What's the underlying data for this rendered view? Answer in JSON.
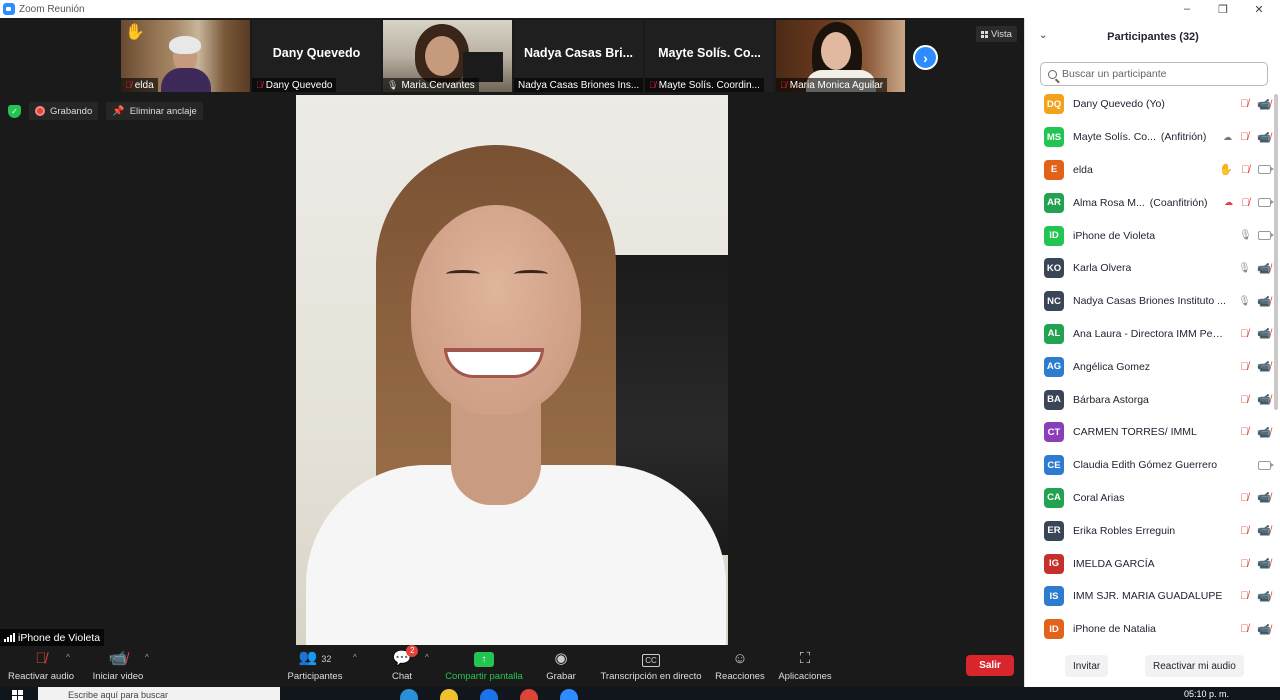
{
  "window": {
    "title": "Zoom Reunión",
    "minimize": "–",
    "maximize": "❐",
    "close": "✕"
  },
  "thumbnails": [
    {
      "label": "elda",
      "muted": true,
      "hand_raised": true,
      "type": "video",
      "bg": "books"
    },
    {
      "label": "Dany Quevedo",
      "big_name": "Dany Quevedo",
      "muted": true,
      "type": "name"
    },
    {
      "label": "Maria.Cervantes",
      "muted": false,
      "type": "video",
      "bg": "room"
    },
    {
      "label": "Nadya Casas Briones Ins...",
      "big_name": "Nadya Casas Bri...",
      "muted": false,
      "type": "name"
    },
    {
      "label": "Mayte Solís. Coordin...",
      "big_name": "Mayte Solís. Co...",
      "muted": true,
      "type": "name"
    },
    {
      "label": "Maria Monica Aguilar",
      "muted": true,
      "type": "video",
      "bg": "wood"
    }
  ],
  "view": {
    "label": "Vista"
  },
  "status": {
    "recording": "Grabando",
    "unpin": "Eliminar anclaje"
  },
  "main_video": {
    "name": "iPhone de Violeta"
  },
  "toolbar": {
    "audio": "Reactivar audio",
    "video": "Iniciar video",
    "participants": "Participantes",
    "participants_count": "32",
    "chat": "Chat",
    "chat_badge": "2",
    "share": "Compartir pantalla",
    "record": "Grabar",
    "cc_icon": "CC",
    "transcription": "Transcripción en directo",
    "reactions": "Reacciones",
    "apps": "Aplicaciones",
    "leave": "Salir"
  },
  "taskbar": {
    "search_placeholder": "Escribe aquí para buscar",
    "time": "05:10 p. m."
  },
  "panel": {
    "title": "Participantes (32)",
    "search_placeholder": "Buscar un participante",
    "participants": [
      {
        "initials": "DQ",
        "color": "#f2a21b",
        "name": "Dany Quevedo (Yo)",
        "role": "",
        "status_icon": "",
        "mic": "muted",
        "cam": "off"
      },
      {
        "initials": "MS",
        "color": "#23c552",
        "name": "Mayte Solís. Co...",
        "role": "(Anfitrión)",
        "status_icon": "cloud",
        "mic": "muted",
        "cam": "off"
      },
      {
        "initials": "E",
        "color": "#e3621b",
        "name": "elda",
        "role": "",
        "status_icon": "hand",
        "mic": "muted",
        "cam": "on"
      },
      {
        "initials": "AR",
        "color": "#23a352",
        "name": "Alma Rosa M...",
        "role": "(Coanfitrión)",
        "status_icon": "cloud-red",
        "mic": "muted",
        "cam": "on"
      },
      {
        "initials": "ID",
        "color": "#23c552",
        "name": "iPhone de Violeta",
        "role": "",
        "status_icon": "",
        "mic": "on",
        "cam": "on"
      },
      {
        "initials": "KO",
        "color": "#3a4658",
        "name": "Karla Olvera",
        "role": "",
        "status_icon": "",
        "mic": "on",
        "cam": "off"
      },
      {
        "initials": "NC",
        "color": "#3a4658",
        "name": "Nadya Casas Briones Instituto ...",
        "role": "",
        "status_icon": "",
        "mic": "on",
        "cam": "off"
      },
      {
        "initials": "AL",
        "color": "#23a352",
        "name": "Ana Laura - Directora IMM Ped...",
        "role": "",
        "status_icon": "",
        "mic": "muted",
        "cam": "off"
      },
      {
        "initials": "AG",
        "color": "#2d7ccf",
        "name": "Angélica Gomez",
        "role": "",
        "status_icon": "",
        "mic": "muted",
        "cam": "off"
      },
      {
        "initials": "BA",
        "color": "#3a4658",
        "name": "Bárbara Astorga",
        "role": "",
        "status_icon": "",
        "mic": "muted",
        "cam": "off"
      },
      {
        "initials": "CT",
        "color": "#8a3fb8",
        "name": "CARMEN TORRES/ IMML",
        "role": "",
        "status_icon": "",
        "mic": "muted",
        "cam": "off"
      },
      {
        "initials": "CE",
        "color": "#2d7ccf",
        "name": "Claudia Edith Gómez Guerrero",
        "role": "",
        "status_icon": "",
        "mic": "",
        "cam": "on"
      },
      {
        "initials": "CA",
        "color": "#23a352",
        "name": "Coral Arias",
        "role": "",
        "status_icon": "",
        "mic": "muted",
        "cam": "off"
      },
      {
        "initials": "ER",
        "color": "#3a4658",
        "name": "Erika Robles Erreguin",
        "role": "",
        "status_icon": "",
        "mic": "muted",
        "cam": "off"
      },
      {
        "initials": "IG",
        "color": "#c5302b",
        "name": "IMELDA GARCÍA",
        "role": "",
        "status_icon": "",
        "mic": "muted",
        "cam": "off"
      },
      {
        "initials": "IS",
        "color": "#2d7ccf",
        "name": "IMM SJR. MARIA GUADALUPE",
        "role": "",
        "status_icon": "",
        "mic": "muted",
        "cam": "off"
      },
      {
        "initials": "ID",
        "color": "#e3621b",
        "name": "iPhone de Natalia",
        "role": "",
        "status_icon": "",
        "mic": "muted",
        "cam": "off"
      }
    ],
    "invite": "Invitar",
    "reactivate_audio": "Reactivar mi audio"
  }
}
